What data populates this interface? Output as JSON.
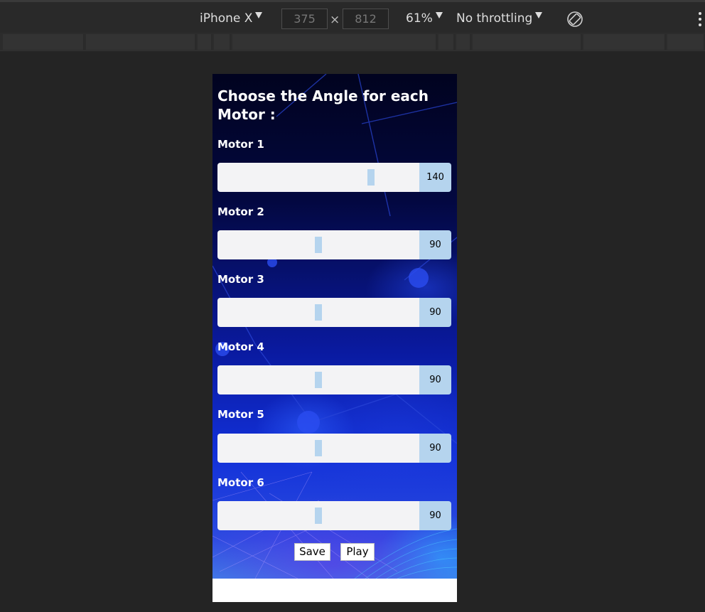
{
  "devtools": {
    "device": "iPhone X",
    "width": "375",
    "height": "812",
    "times_symbol": "×",
    "zoom": "61%",
    "throttling": "No throttling"
  },
  "app": {
    "title": "Choose the Angle for each Motor :",
    "slider_range": [
      0,
      180
    ],
    "motors": [
      {
        "label": "Motor 1",
        "value": "140",
        "angle": 140
      },
      {
        "label": "Motor 2",
        "value": "90",
        "angle": 90
      },
      {
        "label": "Motor 3",
        "value": "90",
        "angle": 90
      },
      {
        "label": "Motor 4",
        "value": "90",
        "angle": 90
      },
      {
        "label": "Motor 5",
        "value": "90",
        "angle": 90
      },
      {
        "label": "Motor 6",
        "value": "90",
        "angle": 90
      }
    ],
    "save_label": "Save",
    "play_label": "Play"
  },
  "colors": {
    "slider_track": "#f3f3f5",
    "slider_accent": "#b5d4ee",
    "page_background": "#242424"
  }
}
